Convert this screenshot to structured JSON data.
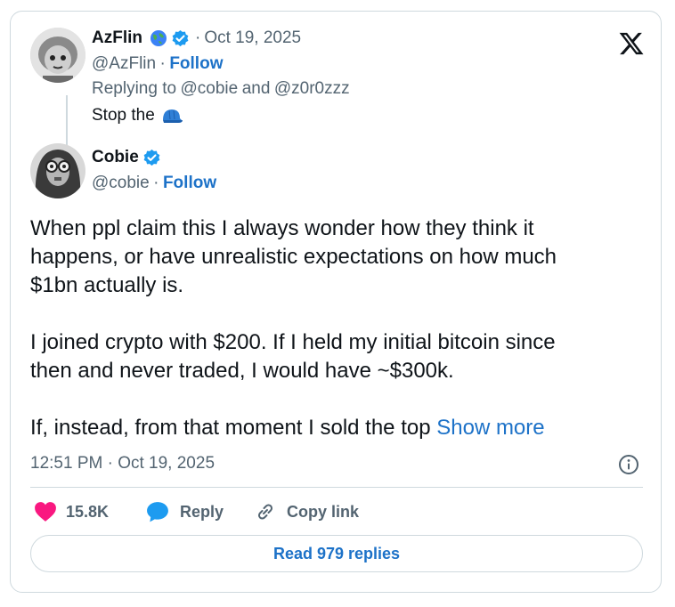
{
  "parent_tweet": {
    "display_name": "AzFlin",
    "handle": "@AzFlin",
    "separator": "·",
    "date": "Oct 19, 2025",
    "follow_label": "Follow",
    "replying_prefix": "Replying to",
    "replying_user1": "@cobie",
    "replying_and": "and",
    "replying_user2": "@z0r0zzz",
    "text": "Stop the",
    "emoji_icon": "blue-cap-icon"
  },
  "main_tweet": {
    "display_name": "Cobie",
    "handle": "@cobie",
    "separator": "·",
    "follow_label": "Follow",
    "paragraph1_line1": "When ppl claim this I always wonder how they think it",
    "paragraph1_line2": "happens, or have unrealistic expectations on how much",
    "paragraph1_line3": "$1bn actually is.",
    "paragraph2_line1": "I joined crypto with $200. If I held my initial bitcoin since",
    "paragraph2_line2": "then and never traded, I would have ~$300k.",
    "paragraph3_line1": "If, instead, from that moment I sold the top",
    "show_more_label": "Show more",
    "timestamp": "12:51 PM · Oct 19, 2025"
  },
  "actions": {
    "like_count": "15.8K",
    "reply_label": "Reply",
    "copy_link_label": "Copy link"
  },
  "read_replies_label": "Read 979 replies",
  "colors": {
    "accent": "#1d72c8",
    "verified": "#1d9bf0",
    "like": "#f91880",
    "muted": "#536471",
    "border": "#cfd9de"
  }
}
